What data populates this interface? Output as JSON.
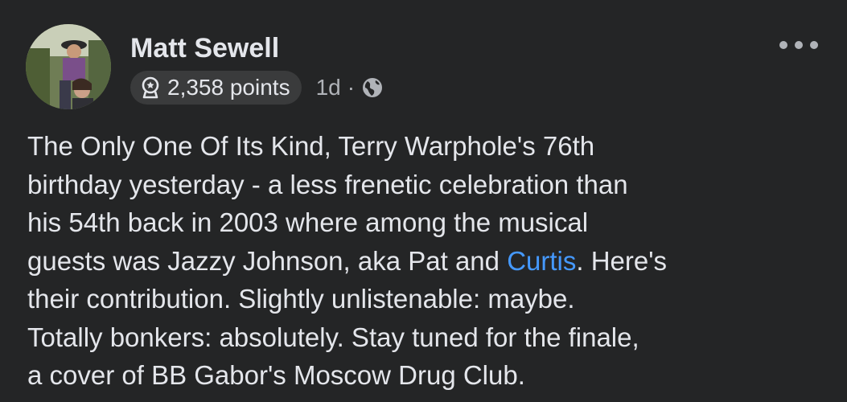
{
  "author": {
    "name": "Matt Sewell",
    "points": "2,358 points",
    "time": "1d",
    "separator": "·"
  },
  "post": {
    "lines": [
      "The Only One Of Its Kind, Terry Warphole's 76th",
      "birthday yesterday - a less frenetic celebration than",
      "his 54th back in 2003 where among the musical"
    ],
    "line4_before": "guests was Jazzy Johnson, aka Pat and ",
    "mention": "Curtis",
    "line4_after": ". Here's",
    "lines_after": [
      "their contribution. Slightly unlistenable: maybe.",
      "Totally bonkers: absolutely. Stay tuned for the finale,",
      "a cover of BB Gabor's Moscow Drug Club."
    ]
  },
  "icons": {
    "badge": "badge-icon",
    "audience": "globe-icon",
    "more": "more-options-icon"
  },
  "colors": {
    "background": "#242526",
    "text": "#e4e6eb",
    "secondary": "#b0b3b8",
    "link": "#4599ff",
    "badge_bg": "#3a3b3c"
  }
}
